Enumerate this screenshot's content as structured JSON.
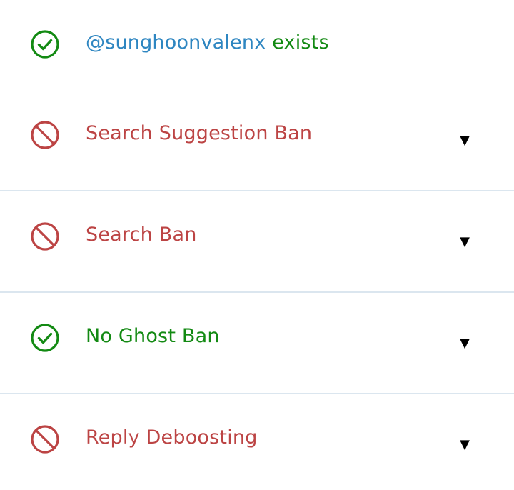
{
  "header": {
    "handle": "@sunghoonvalenx",
    "status_text": " exists",
    "icon": "check-circle-icon"
  },
  "checks": [
    {
      "label": "Search Suggestion Ban",
      "status": "banned",
      "icon": "ban-icon",
      "toggle": "▼"
    },
    {
      "label": "Search Ban",
      "status": "banned",
      "icon": "ban-icon",
      "toggle": "▼"
    },
    {
      "label": "No Ghost Ban",
      "status": "ok",
      "icon": "check-circle-icon",
      "toggle": "▼"
    },
    {
      "label": "Reply Deboosting",
      "status": "banned",
      "icon": "ban-icon",
      "toggle": "▼"
    }
  ],
  "colors": {
    "ok": "#138a13",
    "banned": "#bc4444",
    "handle": "#2e86c1",
    "divider": "#dbe6ef"
  }
}
